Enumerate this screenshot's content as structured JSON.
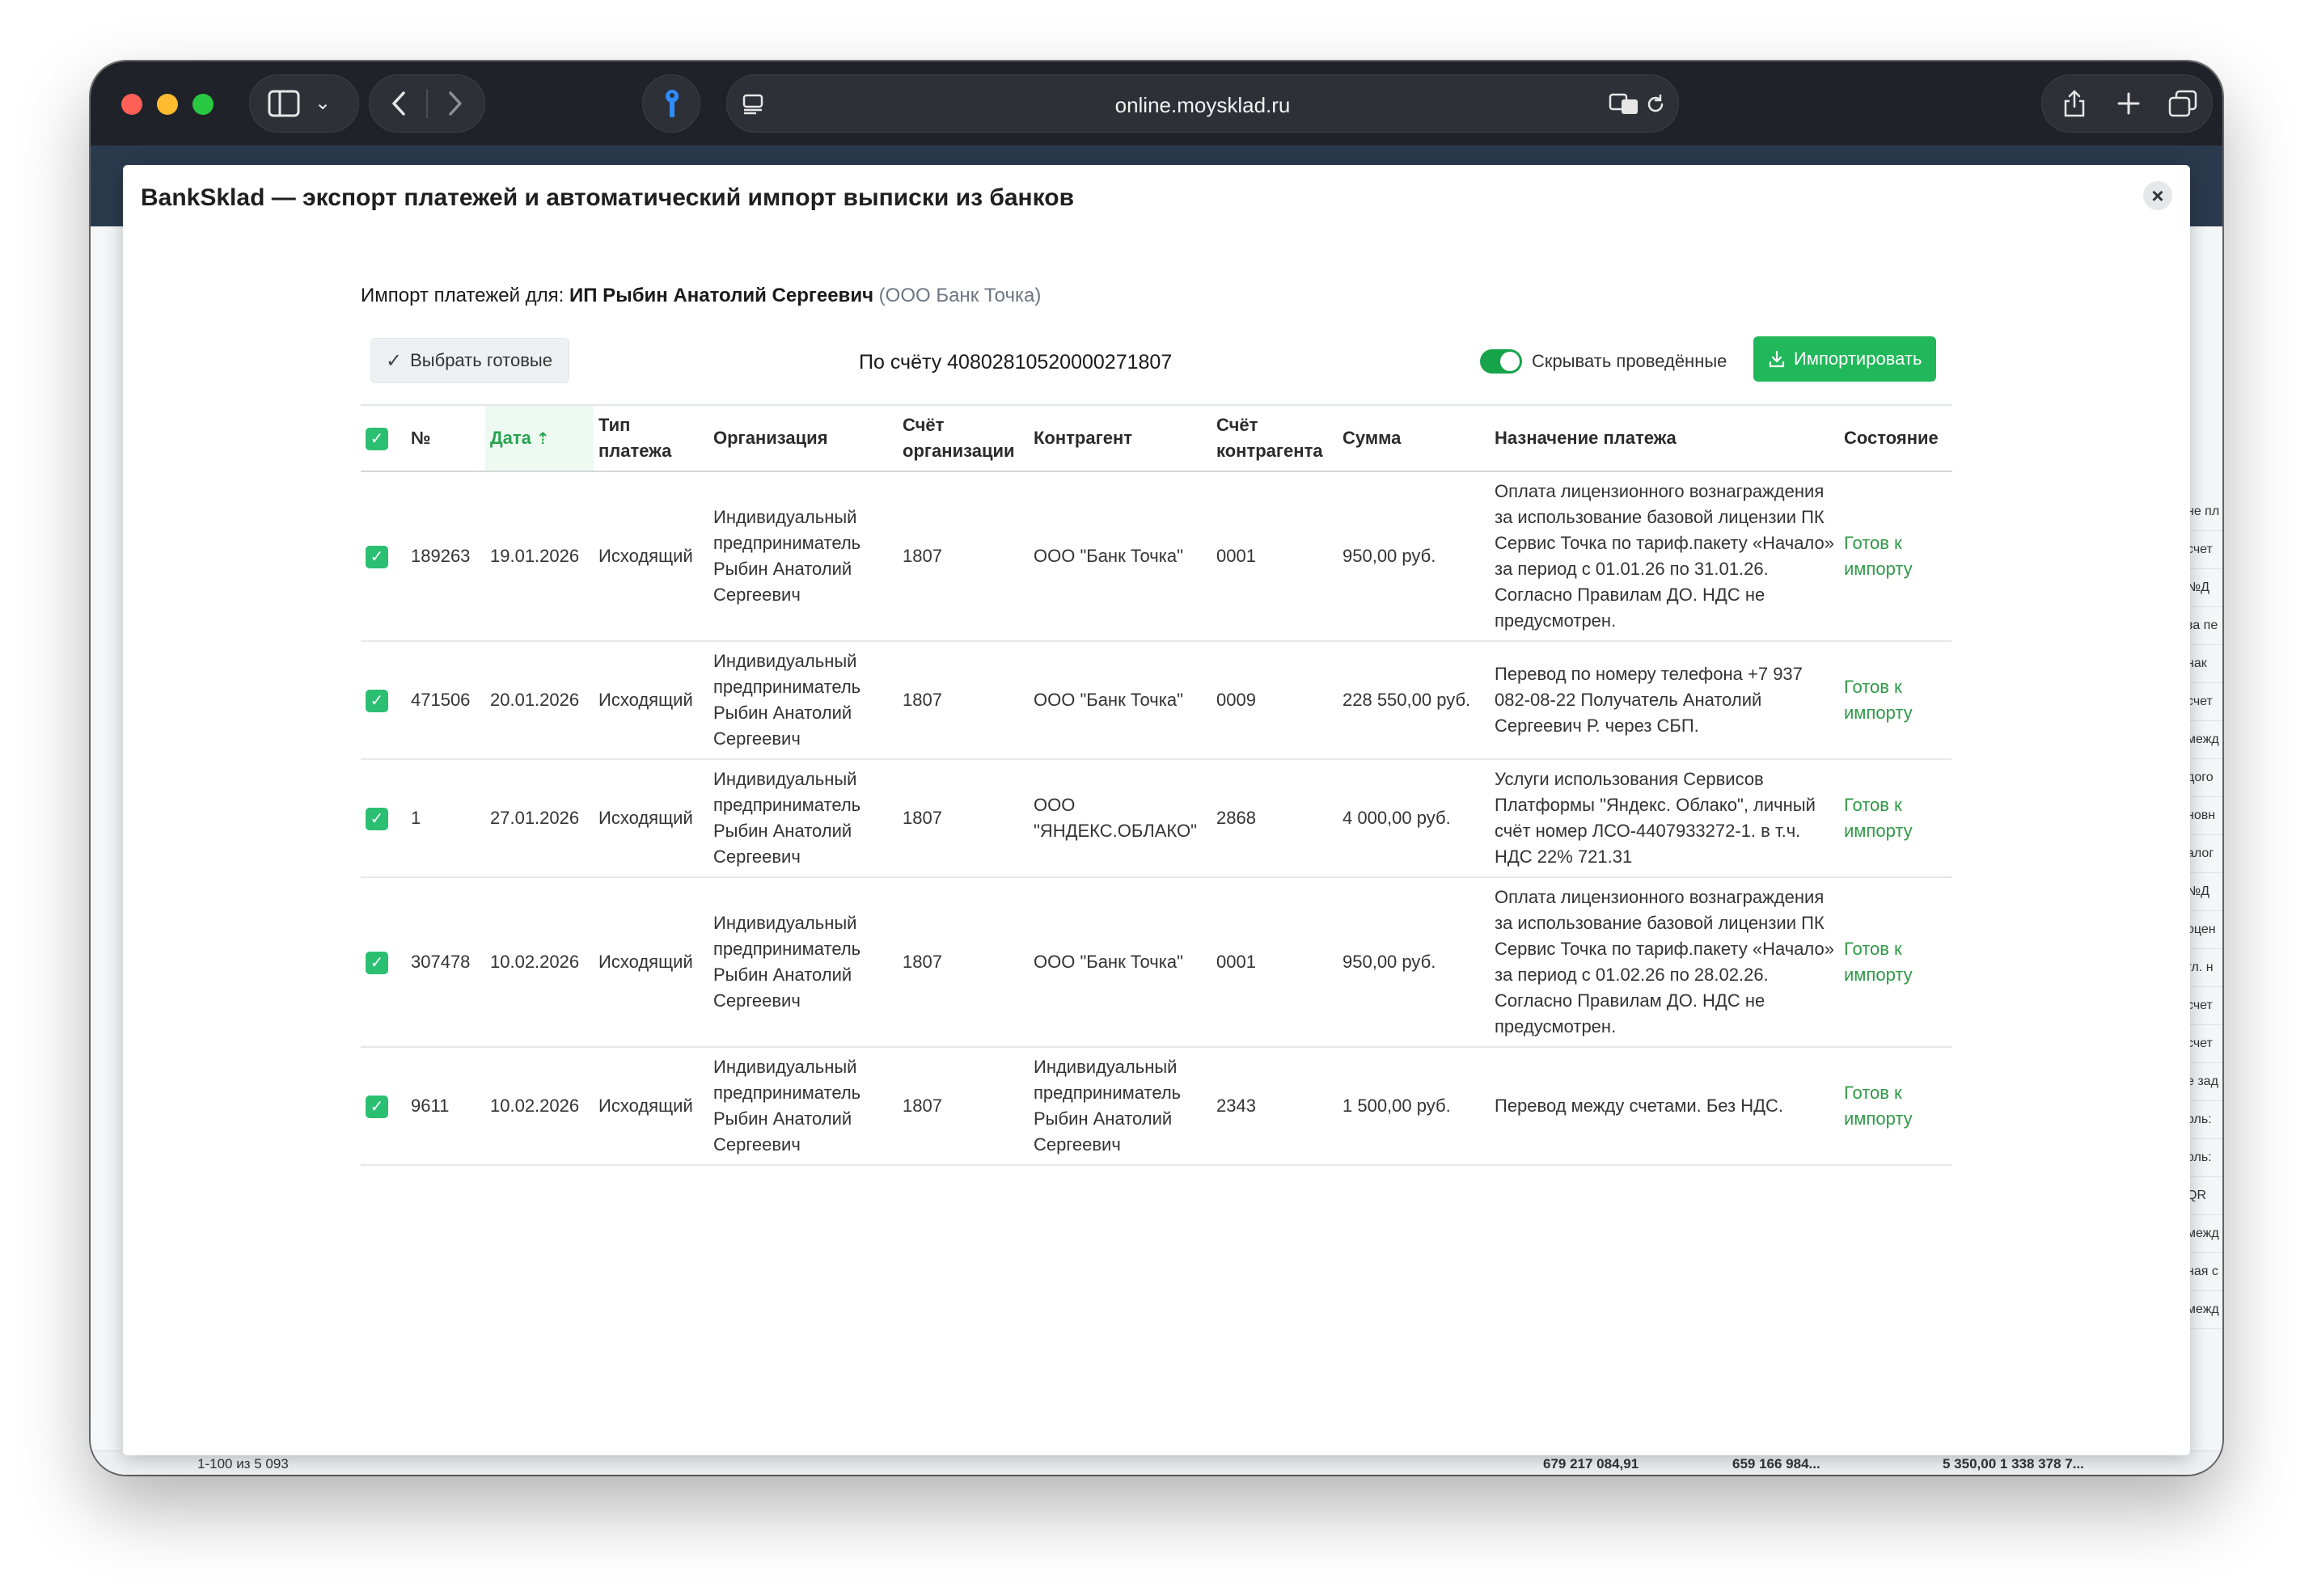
{
  "browser": {
    "url": "online.moysklad.ru"
  },
  "modal": {
    "title": "BankSklad — экспорт платежей и автоматический импорт выписки из банков",
    "close": "×",
    "import_prefix": "Импорт платежей для:",
    "org_name": "ИП Рыбин Анатолий Сергеевич",
    "bank_name": "(ООО Банк Точка)",
    "select_ready_label": "Выбрать готовые",
    "account_label": "По счёту 40802810520000271807",
    "hide_posted_label": "Скрывать проведённые",
    "import_button_label": "Импортировать"
  },
  "table": {
    "headers": {
      "num": "№",
      "date": "Дата",
      "type": "Тип платежа",
      "org": "Организация",
      "org_acc": "Счёт организации",
      "counterparty": "Контрагент",
      "cp_acc": "Счёт контрагента",
      "sum": "Сумма",
      "purpose": "Назначение платежа",
      "status": "Состояние"
    },
    "rows": [
      {
        "num": "189263",
        "date": "19.01.2026",
        "type": "Исходящий",
        "org": "Индивидуальный предприниматель Рыбин Анатолий Сергеевич",
        "org_acc": "1807",
        "counterparty": "ООО \"Банк Точка\"",
        "cp_acc": "0001",
        "sum": "950,00 руб.",
        "purpose": "Оплата лицензионного вознаграждения за использование базовой лицензии ПК Сервис Точка по тариф.пакету «Начало» за период с 01.01.26 по 31.01.26. Согласно Правилам ДО. НДС не предусмотрен.",
        "status": "Готов к импорту"
      },
      {
        "num": "471506",
        "date": "20.01.2026",
        "type": "Исходящий",
        "org": "Индивидуальный предприниматель Рыбин Анатолий Сергеевич",
        "org_acc": "1807",
        "counterparty": "ООО \"Банк Точка\"",
        "cp_acc": "0009",
        "sum": "228 550,00 руб.",
        "purpose": "Перевод по номеру телефона +7 937 082-08-22 Получатель Анатолий Сергеевич Р. через СБП.",
        "status": "Готов к импорту"
      },
      {
        "num": "1",
        "date": "27.01.2026",
        "type": "Исходящий",
        "org": "Индивидуальный предприниматель Рыбин Анатолий Сергеевич",
        "org_acc": "1807",
        "counterparty": "ООО \"ЯНДЕКС.ОБЛАКО\"",
        "cp_acc": "2868",
        "sum": "4 000,00 руб.",
        "purpose": "Услуги использования Сервисов Платформы \"Яндекс. Облако\", личный счёт номер ЛСО-4407933272-1. в т.ч. НДС 22% 721.31",
        "status": "Готов к импорту"
      },
      {
        "num": "307478",
        "date": "10.02.2026",
        "type": "Исходящий",
        "org": "Индивидуальный предприниматель Рыбин Анатолий Сергеевич",
        "org_acc": "1807",
        "counterparty": "ООО \"Банк Точка\"",
        "cp_acc": "0001",
        "sum": "950,00 руб.",
        "purpose": "Оплата лицензионного вознаграждения за использование базовой лицензии ПК Сервис Точка по тариф.пакету «Начало» за период с 01.02.26 по 28.02.26. Согласно Правилам ДО. НДС не предусмотрен.",
        "status": "Готов к импорту"
      },
      {
        "num": "9611",
        "date": "10.02.2026",
        "type": "Исходящий",
        "org": "Индивидуальный предприниматель Рыбин Анатолий Сергеевич",
        "org_acc": "1807",
        "counterparty": "Индивидуальный предприниматель Рыбин Анатолий Сергеевич",
        "cp_acc": "2343",
        "sum": "1 500,00 руб.",
        "purpose": "Перевод между счетами. Без НДС.",
        "status": "Готов к импорту"
      }
    ]
  },
  "app_background": {
    "pager": "1-100 из 5 093",
    "total_1": "679 217 084,91",
    "total_2": "659 166 984...",
    "total_3": "5 350,00 1 338 378 7...",
    "right_fragments": [
      "не пл",
      "счет",
      "№Д",
      "за пе",
      "нак",
      "счет",
      "межд",
      "дого",
      "новн",
      "алог",
      "№Д",
      "оцен",
      "гл. н",
      "счет",
      "счет",
      "е зад",
      "оль:",
      "оль:",
      "QR",
      "межд",
      "ная с",
      "межд"
    ]
  }
}
